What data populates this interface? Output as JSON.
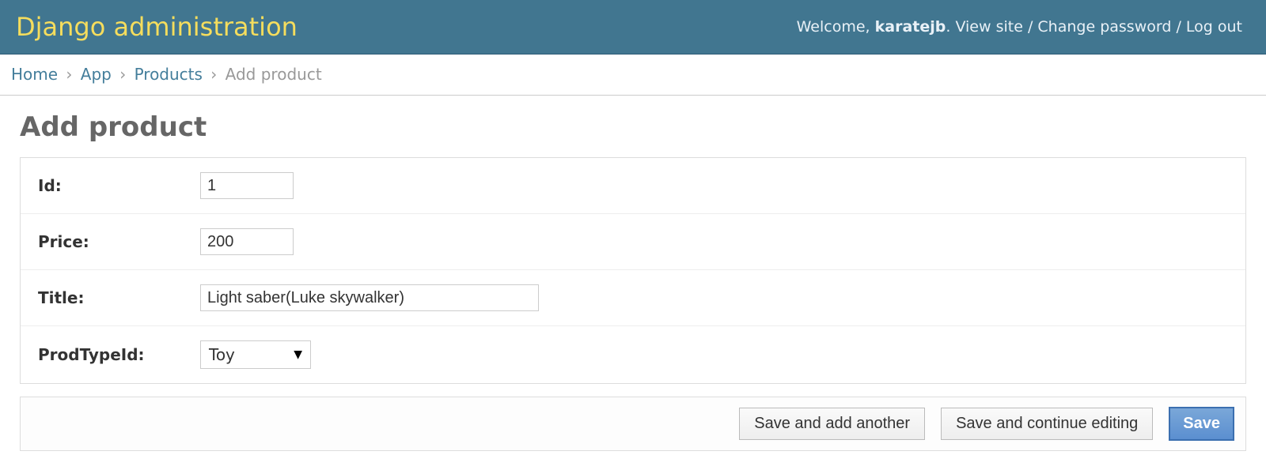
{
  "header": {
    "branding": "Django administration",
    "welcome_prefix": "Welcome, ",
    "username": "karatejb",
    "view_site": "View site",
    "change_password": "Change password",
    "logout": "Log out"
  },
  "breadcrumbs": {
    "home": "Home",
    "app": "App",
    "model": "Products",
    "current": "Add product"
  },
  "page": {
    "title": "Add product"
  },
  "form": {
    "id": {
      "label": "Id:",
      "value": "1"
    },
    "price": {
      "label": "Price:",
      "value": "200"
    },
    "title": {
      "label": "Title:",
      "value": "Light saber(Luke skywalker)"
    },
    "prodtype": {
      "label": "ProdTypeId:",
      "selected": "Toy"
    }
  },
  "submit": {
    "save_add_another": "Save and add another",
    "save_continue": "Save and continue editing",
    "save": "Save"
  }
}
